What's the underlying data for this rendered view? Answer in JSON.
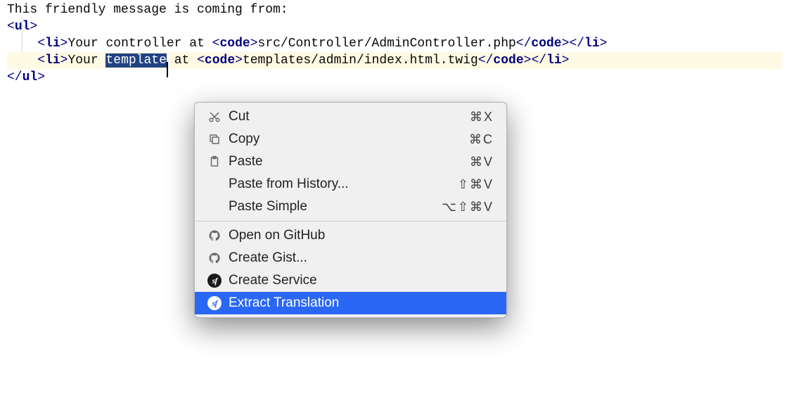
{
  "code": {
    "line1_text": "This friendly message is coming from:",
    "ul_open": "ul",
    "ul_close": "ul",
    "li_open": "li",
    "li_close": "li",
    "code_open": "code",
    "code_close": "code",
    "line2_prefix": "Your controller at ",
    "line2_path": "src/Controller/AdminController.php",
    "line3_prefix": "Your ",
    "line3_selected": "template",
    "line3_suffix": " at ",
    "line3_path": "templates/admin/index.html.twig"
  },
  "menu": {
    "items": [
      {
        "icon": "cut",
        "label": "Cut",
        "shortcut": "⌘X"
      },
      {
        "icon": "copy",
        "label": "Copy",
        "shortcut": "⌘C"
      },
      {
        "icon": "paste",
        "label": "Paste",
        "shortcut": "⌘V"
      },
      {
        "icon": "",
        "label": "Paste from History...",
        "shortcut": "⇧⌘V"
      },
      {
        "icon": "",
        "label": "Paste Simple",
        "shortcut": "⌥⇧⌘V"
      },
      "---",
      {
        "icon": "gh",
        "label": "Open on GitHub",
        "shortcut": ""
      },
      {
        "icon": "gh",
        "label": "Create Gist...",
        "shortcut": ""
      },
      {
        "icon": "sf",
        "label": "Create Service",
        "shortcut": ""
      },
      {
        "icon": "sf",
        "label": "Extract Translation",
        "shortcut": "",
        "highlight": true
      }
    ]
  }
}
